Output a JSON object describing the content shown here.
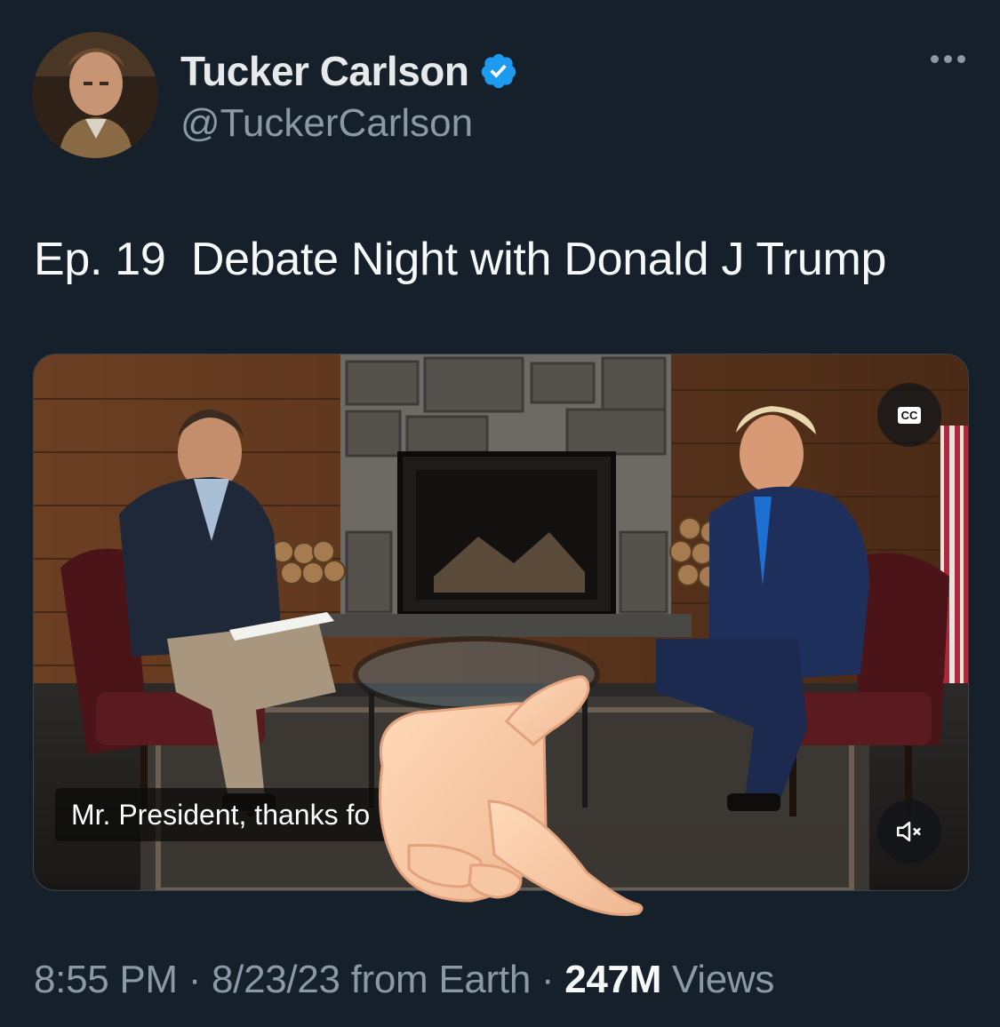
{
  "author": {
    "display_name": "Tucker Carlson",
    "handle": "@TuckerCarlson",
    "verified": true,
    "verified_icon": "verified-badge-icon",
    "verified_color": "#1d9bf0"
  },
  "tweet": {
    "text": "Ep. 19  Debate Night with Donald J Trump"
  },
  "video": {
    "caption": "Mr. President, thanks fo",
    "cc_label": "CC",
    "mute_icon": "speaker-muted-icon"
  },
  "meta": {
    "time": "8:55 PM",
    "sep1": " · ",
    "date": "8/23/23",
    "source": " from Earth",
    "sep2": " · ",
    "views_count": "247M",
    "views_label": " Views"
  },
  "colors": {
    "background": "#15202b",
    "primary_text": "#e7e9ea",
    "secondary_text": "#8b98a5",
    "accent": "#1d9bf0"
  }
}
